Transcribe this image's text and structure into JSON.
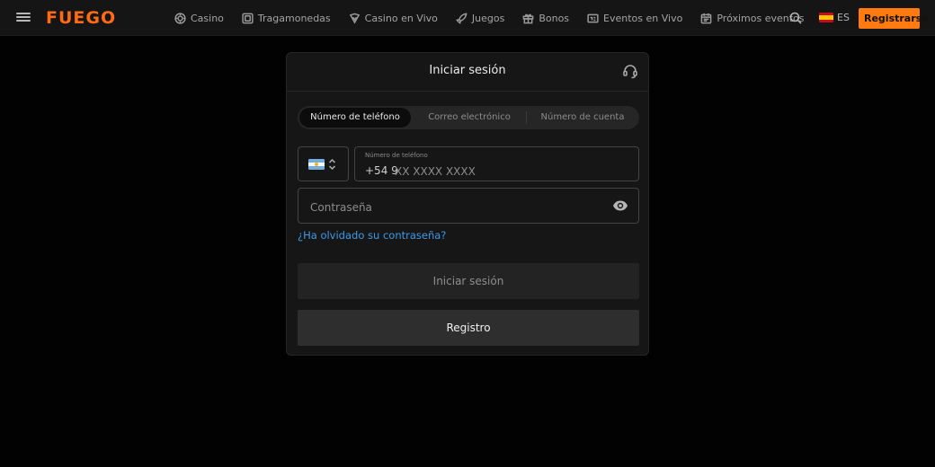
{
  "header": {
    "logo_text": "FUEGO",
    "nav": [
      {
        "label": "Casino",
        "icon": "casino-chip-icon"
      },
      {
        "label": "Tragamonedas",
        "icon": "slots-icon"
      },
      {
        "label": "Casino en Vivo",
        "icon": "live-casino-icon"
      },
      {
        "label": "Juegos",
        "icon": "rocket-icon"
      },
      {
        "label": "Bonos",
        "icon": "gift-icon"
      },
      {
        "label": "Eventos en Vivo",
        "icon": "live-events-icon"
      },
      {
        "label": "Próximos eventos",
        "icon": "calendar-icon"
      }
    ],
    "language": "ES",
    "register_label": "Registrarse"
  },
  "modal": {
    "title": "Iniciar sesión",
    "tabs": [
      "Número de teléfono",
      "Correo electrónico",
      "Número de cuenta"
    ],
    "active_tab": 0,
    "phone_label": "Número de teléfono",
    "phone_prefix": "+54 9",
    "phone_placeholder": "XX XXXX XXXX",
    "password_placeholder": "Contraseña",
    "forgot_label": "¿Ha olvidado su contraseña?",
    "login_label": "Iniciar sesión",
    "register_label": "Registro"
  },
  "colors": {
    "accent": "#ff7a10",
    "link": "#3d9ae8",
    "background": "#020202",
    "panel": "#161616"
  }
}
